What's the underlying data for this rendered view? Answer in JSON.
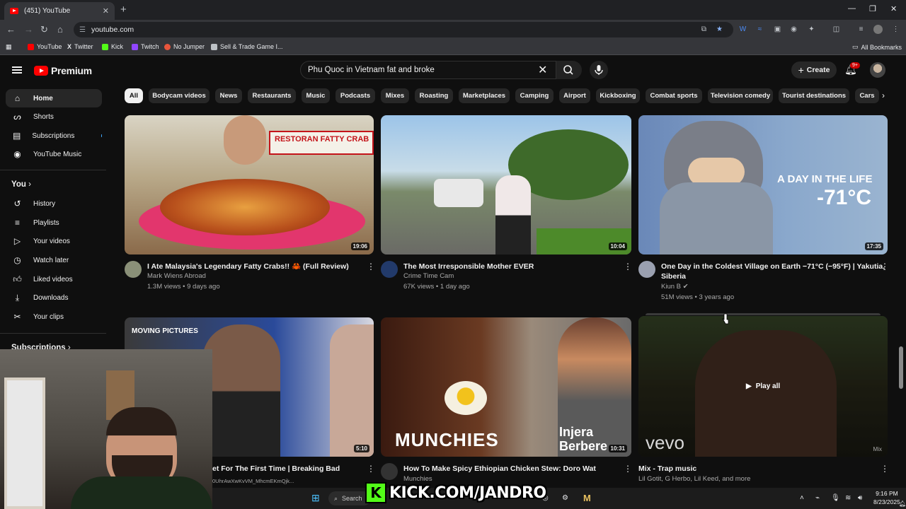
{
  "browser": {
    "tab_title": "(451) YouTube",
    "tab_close": "✕",
    "new_tab": "+",
    "url": "youtube.com",
    "window_controls": [
      "—",
      "❐",
      "✕"
    ],
    "bookmarks": [
      {
        "label": "YouTube",
        "color": "#ff0000"
      },
      {
        "label": "Twitter",
        "color": "#e8eaed"
      },
      {
        "label": "Kick",
        "color": "#53fc18"
      },
      {
        "label": "Twitch",
        "color": "#9146ff"
      },
      {
        "label": "No Jumper",
        "color": "#e8553c"
      },
      {
        "label": "Sell & Trade Game I...",
        "color": "#bdc1c6"
      }
    ],
    "all_bookmarks": "All Bookmarks"
  },
  "header": {
    "logo_text": "Premium",
    "search_query": "Phu Quoc in Vietnam fat and broke",
    "clear": "✕",
    "create_label": "Create",
    "notif_badge": "9+"
  },
  "sidebar": {
    "main": [
      {
        "label": "Home",
        "icon": "home-icon"
      },
      {
        "label": "Shorts",
        "icon": "shorts-icon"
      },
      {
        "label": "Subscriptions",
        "icon": "subscriptions-icon"
      },
      {
        "label": "YouTube Music",
        "icon": "music-icon"
      }
    ],
    "you_heading": "You",
    "you": [
      {
        "label": "History",
        "icon": "history-icon"
      },
      {
        "label": "Playlists",
        "icon": "playlists-icon"
      },
      {
        "label": "Your videos",
        "icon": "your-videos-icon"
      },
      {
        "label": "Watch later",
        "icon": "watch-later-icon"
      },
      {
        "label": "Liked videos",
        "icon": "liked-icon"
      },
      {
        "label": "Downloads",
        "icon": "download-icon"
      },
      {
        "label": "Your clips",
        "icon": "clips-icon"
      }
    ],
    "subs_heading": "Subscriptions"
  },
  "chips": [
    "All",
    "Bodycam videos",
    "News",
    "Restaurants",
    "Music",
    "Podcasts",
    "Mixes",
    "Roasting",
    "Marketplaces",
    "Camping",
    "Airport",
    "Kickboxing",
    "Combat sports",
    "Television comedy",
    "Tourist destinations",
    "Cars"
  ],
  "videos": [
    {
      "title": "I Ate Malaysia's Legendary Fatty Crabs!! 🦀 (Full Review)",
      "channel": "Mark Wiens Abroad",
      "meta": "1.3M views • 9 days ago",
      "duration": "19:06",
      "thumb_text": "RESTORAN FATTY CRAB"
    },
    {
      "title": "The Most Irresponsible Mother EVER",
      "channel": "Crime Time Cam",
      "meta": "67K views • 1 day ago",
      "duration": "10:04",
      "thumb_text": ""
    },
    {
      "title_1": "One Day in the Coldest Village on Earth −71°C (−95°F) | Yakutia,",
      "title_2": "Siberia",
      "channel": "Kiun B",
      "meta": "51M views • 3 years ago",
      "duration": "17:35",
      "thumb_text_1": "A DAY IN THE LIFE",
      "thumb_text_2": "-71°C"
    },
    {
      "title": "et For The First Time | Breaking Bad",
      "channel": "0UhrAwXwKvVM_MhcmEKmQjk...",
      "duration": "5:10",
      "thumb_text": "MOVING PICTURES"
    },
    {
      "title": "How To Make Spicy Ethiopian Chicken Stew: Doro Wat",
      "channel": "Munchies",
      "duration": "10:31",
      "thumb_text_1": "MUNCHIES",
      "thumb_text_2": "Injera",
      "thumb_text_3": "Berbere"
    },
    {
      "title": "Mix - Trap music",
      "channel": "Lil Gotit, G Herbo, Lil Keed, and more",
      "play_all": "Play all",
      "thumb_text": "vevo",
      "mix_badge": "Mix"
    }
  ],
  "overlay": {
    "kick_letter": "K",
    "kick_text": "KICK.COM/JANDRO"
  },
  "taskbar": {
    "search": "Search",
    "time": "9:16 PM",
    "date": "8/23/2025"
  }
}
